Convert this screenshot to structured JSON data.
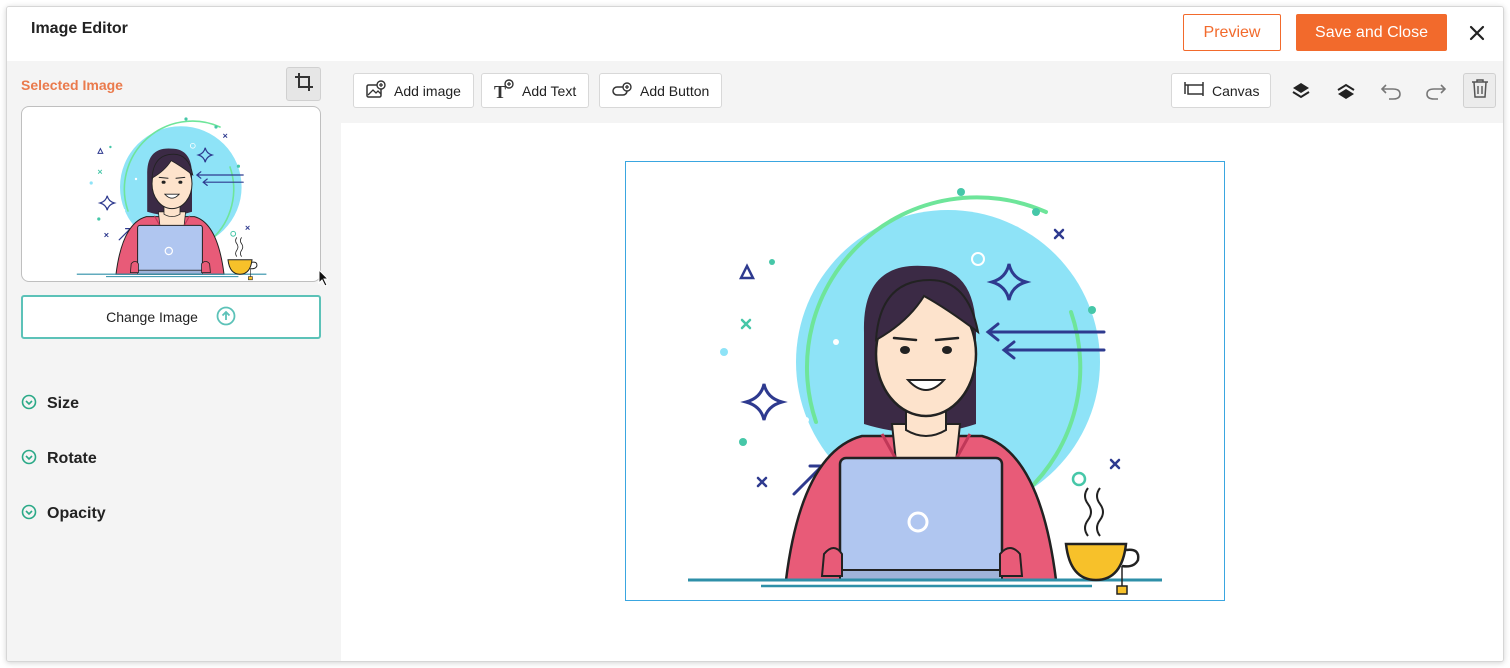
{
  "header": {
    "title": "Image Editor",
    "preview_label": "Preview",
    "save_label": "Save and Close"
  },
  "left_panel": {
    "selected_label": "Selected Image",
    "change_image_label": "Change Image",
    "sections": [
      {
        "label": "Size"
      },
      {
        "label": "Rotate"
      },
      {
        "label": "Opacity"
      }
    ]
  },
  "toolbar": {
    "add_image_label": "Add image",
    "add_text_label": "Add Text",
    "add_button_label": "Add Button",
    "canvas_label": "Canvas"
  },
  "icons": [
    "close-icon",
    "crop-icon",
    "upload-icon",
    "chevron-down-icon",
    "add-image-icon",
    "add-text-icon",
    "add-button-icon",
    "canvas-icon",
    "send-backward-icon",
    "bring-forward-icon",
    "undo-icon",
    "redo-icon",
    "trash-icon"
  ],
  "colors": {
    "accent_orange": "#f26a2c",
    "selected_label": "#ea7a4c",
    "teal": "#5cc2b8",
    "selection_border": "#3aa6e0"
  }
}
